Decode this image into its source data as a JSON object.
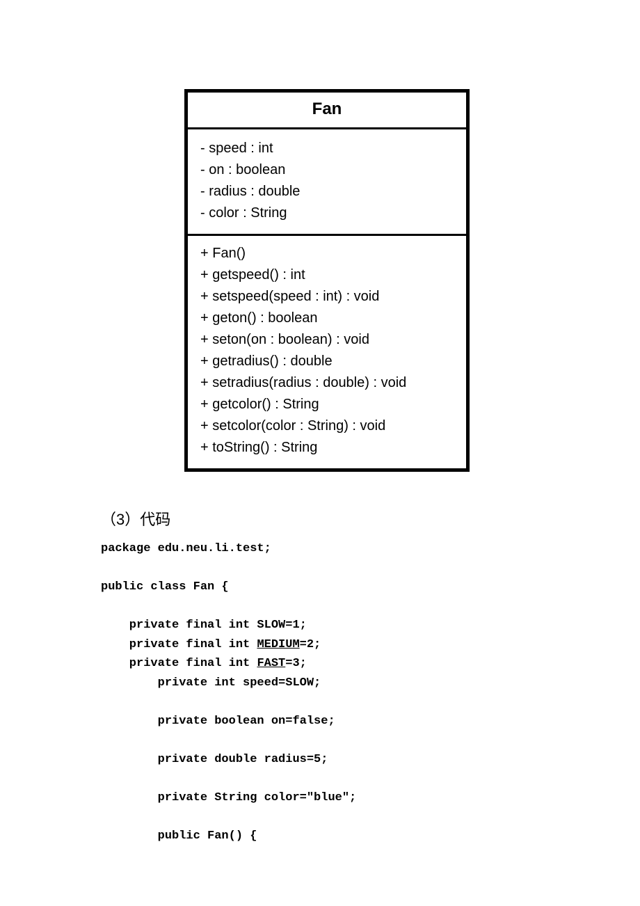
{
  "uml": {
    "class_name": "Fan",
    "attributes": [
      "- speed : int",
      "- on : boolean",
      "- radius : double",
      "- color : String"
    ],
    "methods": [
      "+ Fan()",
      "+ getspeed() : int",
      "+ setspeed(speed : int) : void",
      "+ geton() : boolean",
      "+ seton(on : boolean) : void",
      "+ getradius() : double",
      "+ setradius(radius : double) : void",
      "+ getcolor() : String",
      "+ setcolor(color : String) : void",
      "+ toString() : String"
    ]
  },
  "section_heading": "（3）代码",
  "code": {
    "l1": "package edu.neu.li.test;",
    "l2": "",
    "l3": "public class Fan {",
    "l4": "",
    "l5": "    private final int SLOW=1;",
    "l6a": "    private final int ",
    "l6b": "MEDIUM",
    "l6c": "=2;",
    "l7a": "    private final int ",
    "l7b": "FAST",
    "l7c": "=3;",
    "l8": "        private int speed=SLOW;",
    "l9": "",
    "l10": "        private boolean on=false;",
    "l11": "",
    "l12": "        private double radius=5;",
    "l13": "",
    "l14": "        private String color=\"blue\";",
    "l15": "",
    "l16": "        public Fan() {"
  }
}
